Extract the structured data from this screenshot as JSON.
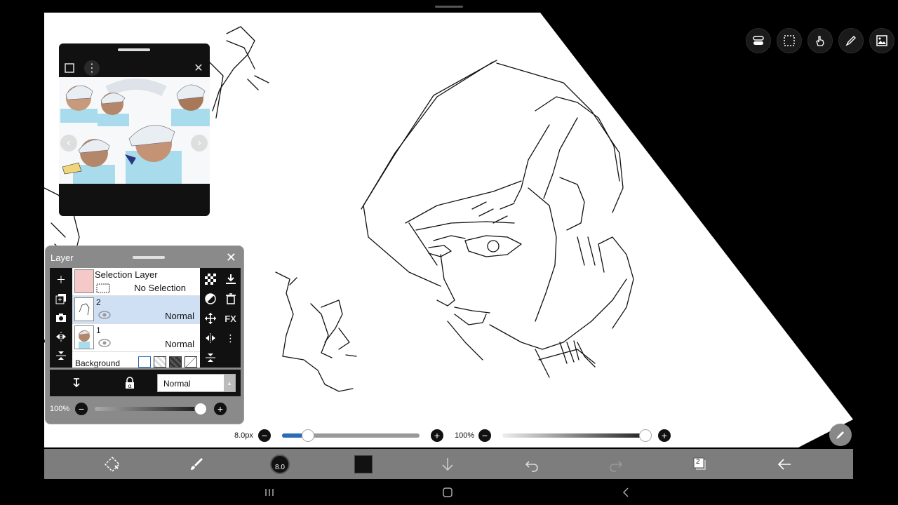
{
  "reference": {
    "close_icon": "close-icon",
    "menu_icon": "more-vertical-icon"
  },
  "layers": {
    "panel_title": "Layer",
    "selection_layer_name": "Selection Layer",
    "selection_status": "No Selection",
    "items": [
      {
        "number": "2",
        "mode": "Normal",
        "selected": true
      },
      {
        "number": "1",
        "mode": "Normal",
        "selected": false
      }
    ],
    "background_label": "Background",
    "blend_mode": "Normal",
    "opacity": "100%",
    "fx_label": "FX"
  },
  "brush": {
    "size_label": "8.0px",
    "size_value": 8.0,
    "size_dot_label": "8.0",
    "opacity_label": "100%",
    "size_fill_fraction": 0.19,
    "opacity_fill_fraction": 1.0
  },
  "bottom_toolbar": {
    "layer_count": "2"
  },
  "colors": {
    "canvas": "#ffffff",
    "toolbar": "#7d7d7d",
    "panel": "#8a8a8a",
    "accent_blue": "#2a6cb5",
    "selected_layer": "#cfe0f5"
  }
}
